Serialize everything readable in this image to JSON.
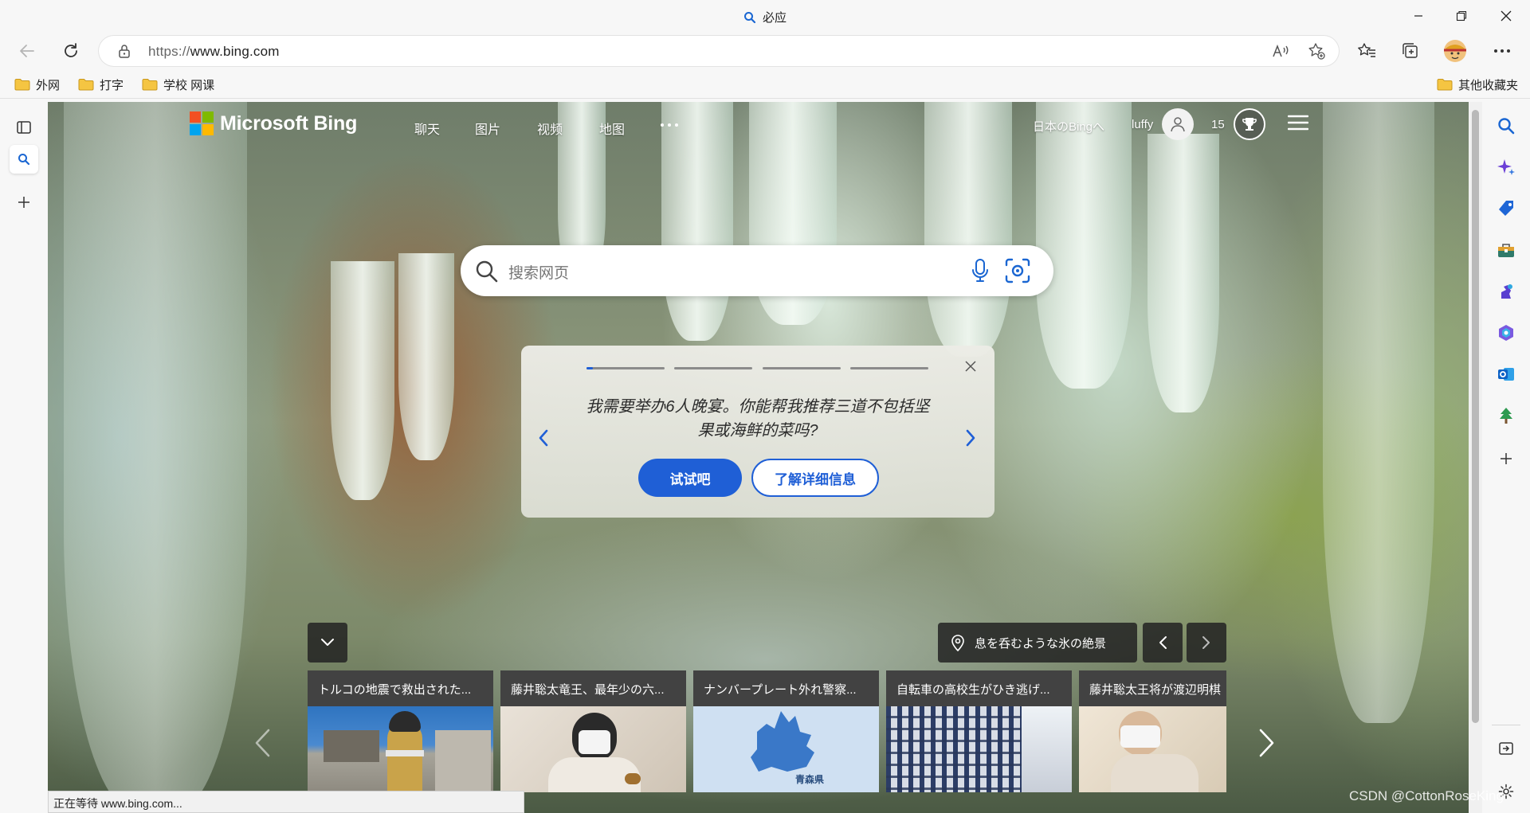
{
  "window": {
    "title": "必应",
    "controls": [
      "minimize-icon",
      "restore-icon",
      "close-icon"
    ]
  },
  "address_bar": {
    "url_scheme": "https://",
    "url_host": "www.bing.com"
  },
  "bookmarks": {
    "items": [
      {
        "label": "外网",
        "icon": "folder-icon"
      },
      {
        "label": "打字",
        "icon": "folder-icon"
      },
      {
        "label": "学校 网课",
        "icon": "folder-icon"
      }
    ],
    "other": "其他收藏夹"
  },
  "bing": {
    "logo_text": "Microsoft Bing",
    "nav": [
      "聊天",
      "图片",
      "视频",
      "地图"
    ],
    "region_link": "日本のBingへ",
    "user_name": "luffy",
    "rewards_points": "15",
    "search_placeholder": "搜索网页"
  },
  "card": {
    "message": "我需要举办6人晚宴。你能帮我推荐三道不包括坚果或海鲜的菜吗?",
    "progress_steps": 4,
    "active_step": 1,
    "try_button": "试试吧",
    "learn_button": "了解详细信息"
  },
  "image_info": {
    "caption": "息を呑むような氷の絶景"
  },
  "news": [
    {
      "title": "トルコの地震で救出された..."
    },
    {
      "title": "藤井聡太竜王、最年少の六..."
    },
    {
      "title": "ナンバープレート外れ警察..."
    },
    {
      "title": "自転車の高校生がひき逃げ..."
    },
    {
      "title": "藤井聡太王将が渡辺明棋"
    }
  ],
  "map_label": "青森県",
  "status_text": "正在等待 www.bing.com...",
  "watermark": "CSDN @CottonRoseKing",
  "colors": {
    "accent": "#1f5fd6",
    "search_icon_blue": "#1a66d2"
  }
}
